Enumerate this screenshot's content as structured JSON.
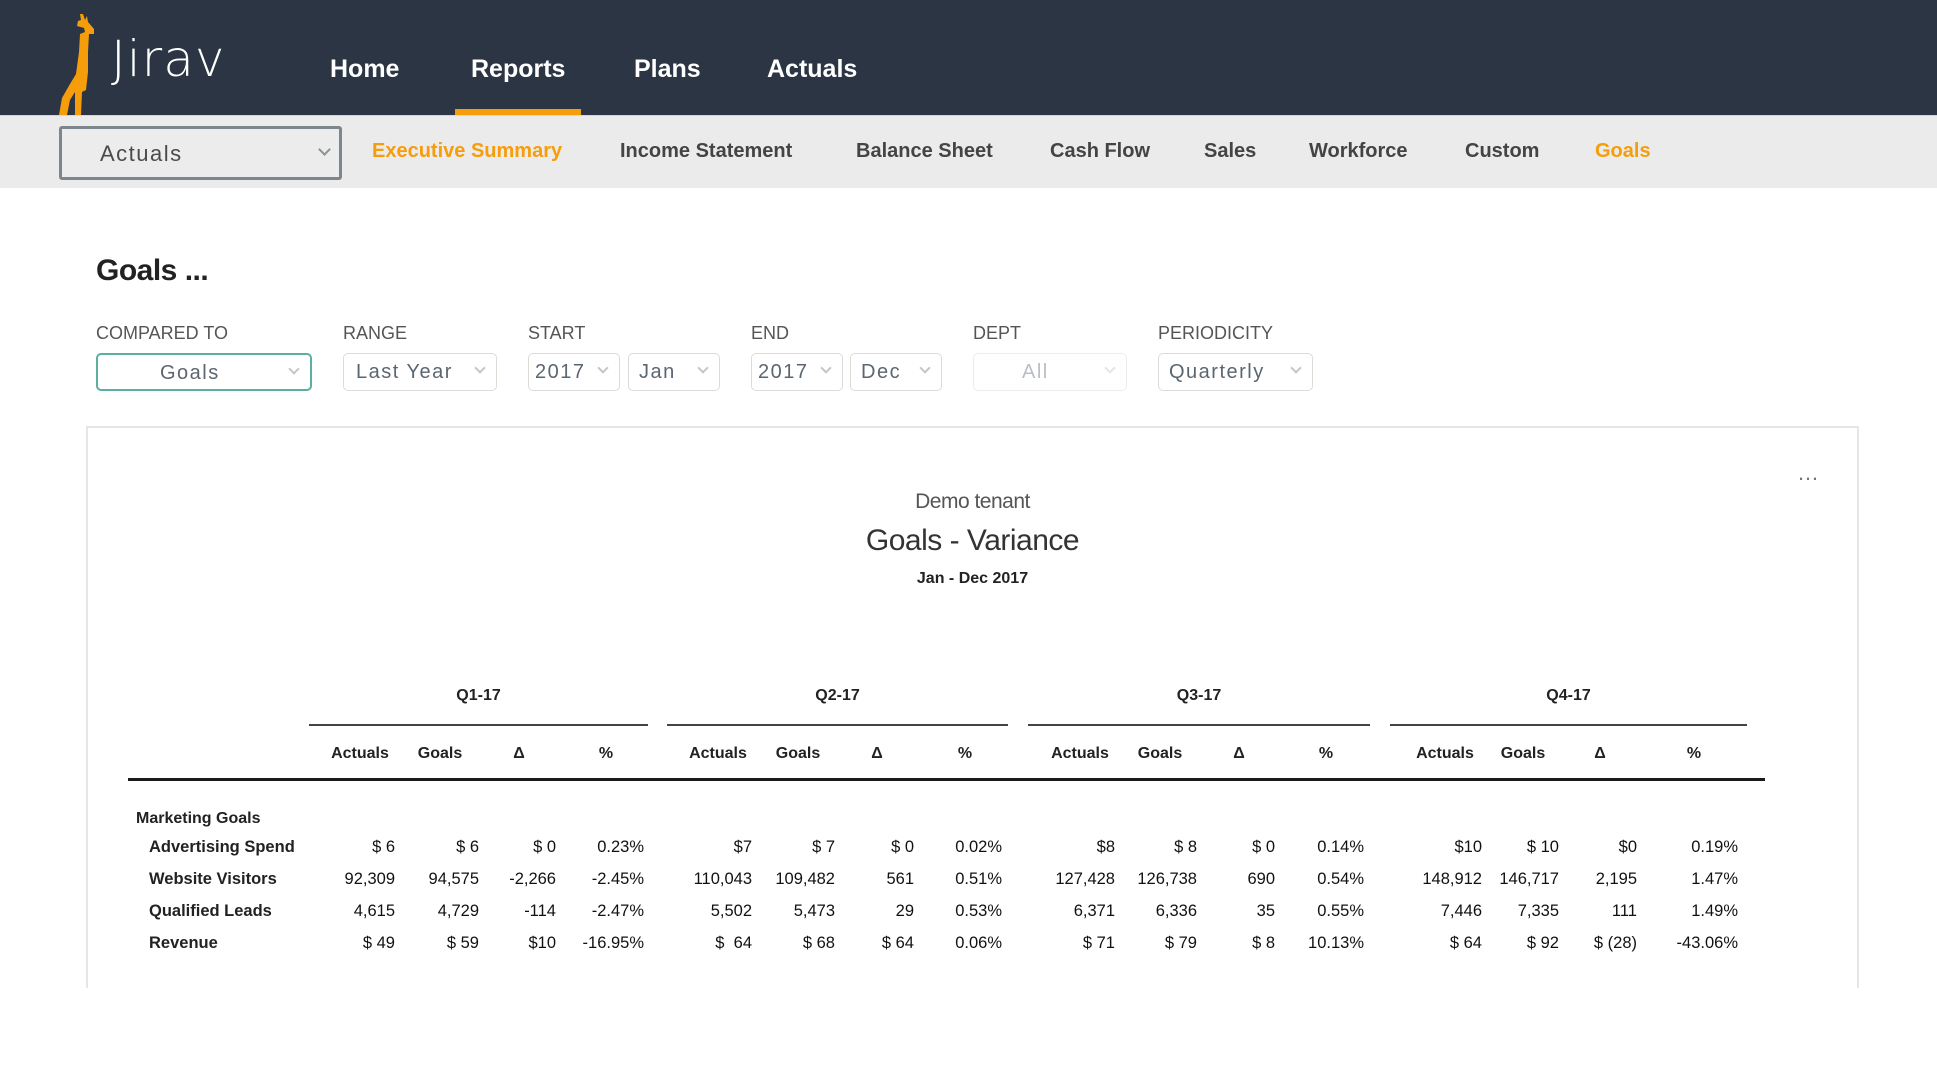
{
  "app": {
    "logo_text": "Jirav",
    "brand_color": "#f59d0b",
    "header_color": "#2b3544"
  },
  "mainnav": {
    "items": [
      {
        "label": "Home",
        "active": false
      },
      {
        "label": "Reports",
        "active": true
      },
      {
        "label": "Plans",
        "active": false
      },
      {
        "label": "Actuals",
        "active": false
      }
    ]
  },
  "subnav": {
    "view_select": {
      "value": "Actuals",
      "icon": "chevron-down-icon"
    },
    "tabs": [
      {
        "label": "Executive Summary",
        "active": true
      },
      {
        "label": "Income Statement",
        "active": false
      },
      {
        "label": "Balance Sheet",
        "active": false
      },
      {
        "label": "Cash Flow",
        "active": false
      },
      {
        "label": "Sales",
        "active": false
      },
      {
        "label": "Workforce",
        "active": false
      },
      {
        "label": "Custom",
        "active": false
      },
      {
        "label": "Goals",
        "active": true
      }
    ]
  },
  "page": {
    "title": "Goals ..."
  },
  "filters": {
    "compared_to": {
      "label": "COMPARED TO",
      "value": "Goals"
    },
    "range": {
      "label": "RANGE",
      "value": "Last Year"
    },
    "start": {
      "label": "START",
      "year": "2017",
      "month": "Jan"
    },
    "end": {
      "label": "END",
      "year": "2017",
      "month": "Dec"
    },
    "dept": {
      "label": "DEPT",
      "value": "All",
      "disabled": true
    },
    "periodicity": {
      "label": "PERIODICITY",
      "value": "Quarterly"
    }
  },
  "report": {
    "more_icon": "…",
    "tenant": "Demo tenant",
    "title": "Goals - Variance",
    "range": "Jan - Dec 2017",
    "columns": [
      "Actuals",
      "Goals",
      "Δ",
      "%"
    ],
    "quarters": [
      "Q1-17",
      "Q2-17",
      "Q3-17",
      "Q4-17"
    ],
    "group": "Marketing Goals",
    "rows": [
      {
        "label": "Advertising Spend",
        "values": [
          [
            "$ 6",
            "$ 6",
            "$ 0",
            "0.23%"
          ],
          [
            "$7",
            "$ 7",
            "$ 0",
            "0.02%"
          ],
          [
            "$8",
            "$ 8",
            "$ 0",
            "0.14%"
          ],
          [
            "$10",
            "$ 10",
            "$0",
            "0.19%"
          ]
        ]
      },
      {
        "label": "Website Visitors",
        "values": [
          [
            "92,309",
            "94,575",
            "-2,266",
            "-2.45%"
          ],
          [
            "110,043",
            "109,482",
            "561",
            "0.51%"
          ],
          [
            "127,428",
            "126,738",
            "690",
            "0.54%"
          ],
          [
            "148,912",
            "146,717",
            "2,195",
            "1.47%"
          ]
        ]
      },
      {
        "label": "Qualified Leads",
        "values": [
          [
            "4,615",
            "4,729",
            "-114",
            "-2.47%"
          ],
          [
            "5,502",
            "5,473",
            "29",
            "0.53%"
          ],
          [
            "6,371",
            "6,336",
            "35",
            "0.55%"
          ],
          [
            "7,446",
            "7,335",
            "111",
            "1.49%"
          ]
        ]
      },
      {
        "label": "Revenue",
        "values": [
          [
            "$ 49",
            "$ 59",
            "$10",
            "-16.95%"
          ],
          [
            "$  64",
            "$ 68",
            "$ 64",
            "0.06%"
          ],
          [
            "$ 71",
            "$ 79",
            "$ 8",
            "10.13%"
          ],
          [
            "$ 64",
            "$ 92",
            "$ (28)",
            "-43.06%"
          ]
        ]
      }
    ]
  }
}
